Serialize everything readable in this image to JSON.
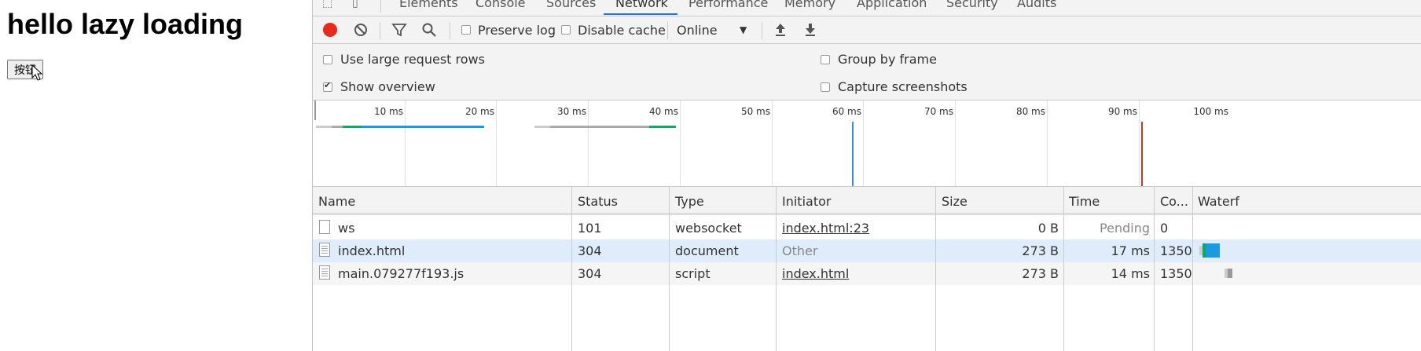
{
  "page": {
    "heading": "hello lazy loading",
    "button_label": "按钮"
  },
  "devtools": {
    "tabs": [
      "Elements",
      "Console",
      "Sources",
      "Network",
      "Performance",
      "Memory",
      "Application",
      "Security",
      "Audits"
    ],
    "active_tab": "Network",
    "toolbar": {
      "preserve_log_label": "Preserve log",
      "disable_cache_label": "Disable cache",
      "throttle_value": "Online"
    },
    "settings": {
      "large_rows_label": "Use large request rows",
      "show_overview_label": "Show overview",
      "group_by_frame_label": "Group by frame",
      "capture_screenshots_label": "Capture screenshots"
    },
    "overview_ticks": [
      "10 ms",
      "20 ms",
      "30 ms",
      "40 ms",
      "50 ms",
      "60 ms",
      "70 ms",
      "80 ms",
      "90 ms",
      "100 ms"
    ],
    "columns": [
      "Name",
      "Status",
      "Type",
      "Initiator",
      "Size",
      "Time",
      "Co...",
      "Waterf"
    ],
    "rows": [
      {
        "name": "ws",
        "status": "101",
        "type": "websocket",
        "initiator": "index.html:23",
        "size": "0 B",
        "time": "Pending",
        "co": "0"
      },
      {
        "name": "index.html",
        "status": "304",
        "type": "document",
        "initiator": "Other",
        "size": "273 B",
        "time": "17 ms",
        "co": "1350"
      },
      {
        "name": "main.079277f193.js",
        "status": "304",
        "type": "script",
        "initiator": "index.html",
        "size": "273 B",
        "time": "14 ms",
        "co": "1350"
      }
    ],
    "colors": {
      "record": "#e8291c",
      "accent": "#1a73e8",
      "selected_row": "#deecfb",
      "bar_blue": "#1a9ae0",
      "bar_green": "#0fa864",
      "dom_line": "#3d8ae6",
      "load_line": "#c0392b"
    }
  }
}
